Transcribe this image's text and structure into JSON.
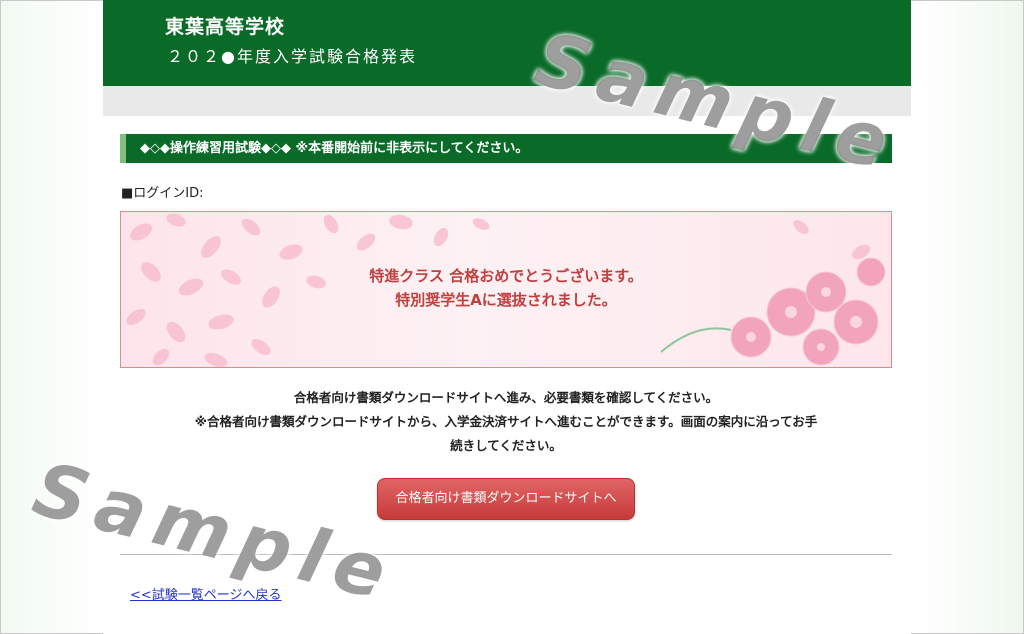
{
  "header": {
    "school_name": "東葉高等学校",
    "title": "２０２●年度入学試験合格発表"
  },
  "notice": {
    "text": "◆◇◆操作練習用試験◆◇◆ ※本番開始前に非表示にしてください。"
  },
  "login": {
    "label": "■ログインID:"
  },
  "result": {
    "line1": "特進クラス 合格おめでとうございます。",
    "line2": "特別奨学生Aに選抜されました。"
  },
  "info": {
    "line1": "合格者向け書類ダウンロードサイトへ進み、必要書類を確認してください。",
    "line2": "※合格者向け書類ダウンロードサイトから、入学金決済サイトへ進むことができます。画面の案内に沿ってお手",
    "line3": "続きしてください。"
  },
  "download_button": {
    "label": "合格者向け書類ダウンロードサイトへ"
  },
  "back_link": {
    "label": "<<試験一覧ページへ戻る"
  },
  "watermarks": {
    "top": "Sample",
    "bottom": "Sample"
  },
  "colors": {
    "header_green": "#0a6a28",
    "result_text": "#c0403f",
    "button_red": "#c83a3a",
    "link_blue": "#2233cc"
  }
}
